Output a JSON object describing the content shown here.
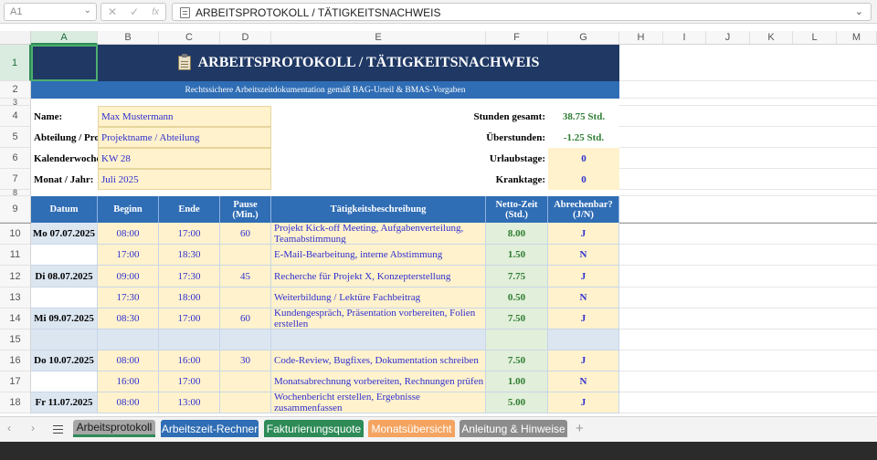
{
  "formula_bar": {
    "cell_ref": "A1",
    "formula_text": "ARBEITSPROTOKOLL / TÄTIGKEITSNACHWEIS",
    "fx_label": "fx"
  },
  "columns": [
    "A",
    "B",
    "C",
    "D",
    "E",
    "F",
    "G",
    "H",
    "I",
    "J",
    "K",
    "L",
    "M"
  ],
  "rows": [
    "1",
    "2",
    "3",
    "4",
    "5",
    "6",
    "7",
    "8",
    "9",
    "10",
    "11",
    "12",
    "13",
    "14",
    "15",
    "16",
    "17",
    "18"
  ],
  "title": "ARBEITSPROTOKOLL / TÄTIGKEITSNACHWEIS",
  "subtitle": "Rechtssichere Arbeitszeitdokumentation gemäß BAG-Urteil & BMAS-Vorgaben",
  "info": {
    "name_label": "Name:",
    "name_value": "Max Mustermann",
    "dept_label": "Abteilung / Pro",
    "dept_value": "Projektname / Abteilung",
    "week_label": "Kalenderwoche",
    "week_value": "KW 28",
    "month_label": "Monat / Jahr:",
    "month_value": "Juli 2025"
  },
  "summary": {
    "hours_label": "Stunden gesamt:",
    "hours_value": "38.75 Std.",
    "overtime_label": "Überstunden:",
    "overtime_value": "-1.25 Std.",
    "vacation_label": "Urlaubstage:",
    "vacation_value": "0",
    "sick_label": "Kranktage:",
    "sick_value": "0"
  },
  "table": {
    "headers": {
      "datum": "Datum",
      "beginn": "Beginn",
      "ende": "Ende",
      "pause": "Pause (Min.)",
      "beschreibung": "Tätigkeitsbeschreibung",
      "netto": "Netto-Zeit (Std.)",
      "abrechenbar": "Abrechenbar? (J/N)"
    },
    "rows": [
      {
        "datum": "Mo 07.07.2025",
        "beginn": "08:00",
        "ende": "17:00",
        "pause": "60",
        "desc": "Projekt Kick-off Meeting, Aufgabenverteilung, Teamabstimmung",
        "netto": "8.00",
        "ab": "J"
      },
      {
        "datum": "",
        "beginn": "17:00",
        "ende": "18:30",
        "pause": "",
        "desc": "E-Mail-Bearbeitung, interne Abstimmung",
        "netto": "1.50",
        "ab": "N"
      },
      {
        "datum": "Di 08.07.2025",
        "beginn": "09:00",
        "ende": "17:30",
        "pause": "45",
        "desc": "Recherche für Projekt X, Konzepterstellung",
        "netto": "7.75",
        "ab": "J"
      },
      {
        "datum": "",
        "beginn": "17:30",
        "ende": "18:00",
        "pause": "",
        "desc": "Weiterbildung / Lektüre Fachbeitrag",
        "netto": "0.50",
        "ab": "N"
      },
      {
        "datum": "Mi 09.07.2025",
        "beginn": "08:30",
        "ende": "17:00",
        "pause": "60",
        "desc": "Kundengespräch, Präsentation vorbereiten, Folien erstellen",
        "netto": "7.50",
        "ab": "J"
      },
      {
        "datum": "",
        "beginn": "",
        "ende": "",
        "pause": "",
        "desc": "",
        "netto": "",
        "ab": ""
      },
      {
        "datum": "Do 10.07.2025",
        "beginn": "08:00",
        "ende": "16:00",
        "pause": "30",
        "desc": "Code-Review, Bugfixes, Dokumentation schreiben",
        "netto": "7.50",
        "ab": "J"
      },
      {
        "datum": "",
        "beginn": "16:00",
        "ende": "17:00",
        "pause": "",
        "desc": "Monatsabrechnung vorbereiten, Rechnungen prüfen",
        "netto": "1.00",
        "ab": "N"
      },
      {
        "datum": "Fr 11.07.2025",
        "beginn": "08:00",
        "ende": "13:00",
        "pause": "",
        "desc": "Wochenbericht erstellen, Ergebnisse zusammenfassen",
        "netto": "5.00",
        "ab": "J"
      }
    ]
  },
  "sheet_tabs": [
    {
      "label": "Arbeitsprotokoll",
      "color": "#a6a6a6",
      "active": true
    },
    {
      "label": "Arbeitszeit-Rechner",
      "color": "#2f6db5",
      "active": false
    },
    {
      "label": "Fakturierungsquote",
      "color": "#2e8b57",
      "active": false
    },
    {
      "label": "Monatsübersicht",
      "color": "#f4a460",
      "active": false
    },
    {
      "label": "Anleitung & Hinweise",
      "color": "#8c8c8c",
      "active": false
    }
  ],
  "colors": {
    "banner": "#1f3864",
    "header_blue": "#2f6db5",
    "input_yellow": "#fff2cc",
    "net_green": "#e2efda",
    "date_blue": "#dce6f1"
  }
}
